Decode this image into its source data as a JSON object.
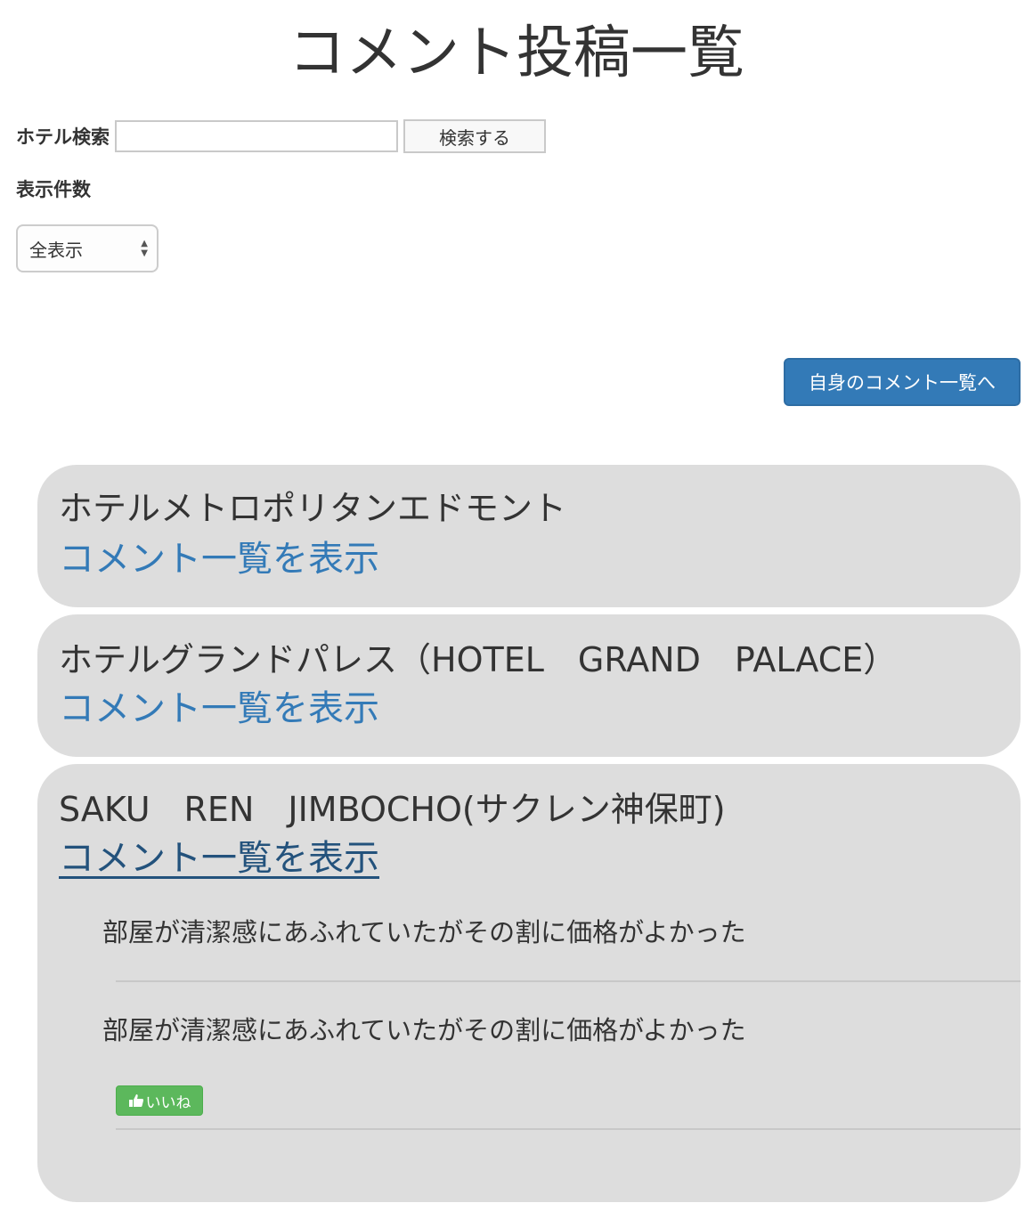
{
  "page": {
    "title": "コメント投稿一覧"
  },
  "search": {
    "label": "ホテル検索",
    "input_value": "",
    "placeholder": "",
    "button_label": "検索する"
  },
  "display_count": {
    "label": "表示件数",
    "selected": "全表示"
  },
  "my_comments_button": "自身のコメント一覧へ",
  "hotels": [
    {
      "name": "ホテルメトロポリタンエドモント",
      "link_label": "コメント一覧を表示"
    },
    {
      "name": "ホテルグランドパレス（HOTEL　GRAND　PALACE）",
      "link_label": "コメント一覧を表示"
    },
    {
      "name": "SAKU　REN　JIMBOCHO(サクレン神保町)",
      "link_label": "コメント一覧を表示",
      "comments": [
        {
          "text": "部屋が清潔感にあふれていたがその割に価格がよかった"
        },
        {
          "text": "部屋が清潔感にあふれていたがその割に価格がよかった",
          "like_label": "いいね"
        }
      ]
    }
  ],
  "colors": {
    "link": "#337ab7",
    "primary_button": "#337ab7",
    "like_button": "#5cb85c",
    "card_background": "#dddddd"
  },
  "icons": {
    "like": "thumbs-up-icon",
    "select": "select-arrows-icon"
  }
}
